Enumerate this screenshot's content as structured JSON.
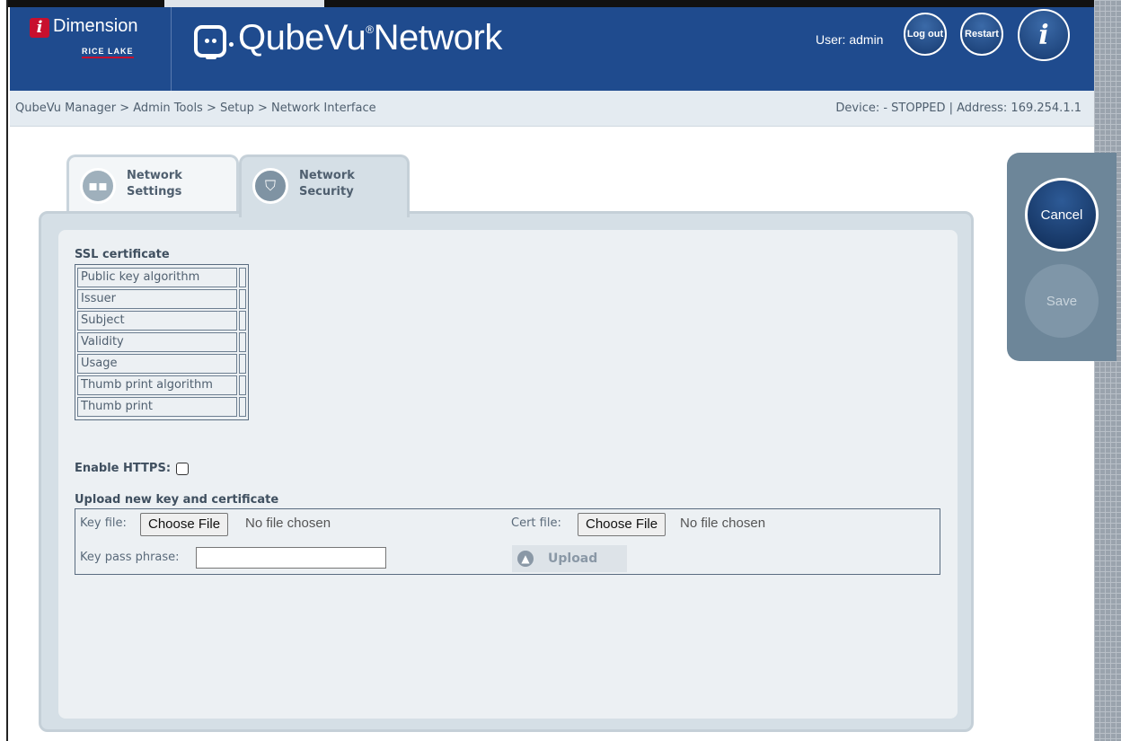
{
  "header": {
    "brand_name": "Dimension",
    "brand_sub": "RICE LAKE",
    "app_title": "QubeVu",
    "app_title_mark": "®",
    "app_title_suffix": "Network",
    "user_label": "User: admin",
    "logout_label": "Log out",
    "restart_label": "Restart",
    "info_label": "i"
  },
  "breadcrumb": "QubeVu Manager > Admin Tools > Setup > Network Interface",
  "device_status": "Device: - STOPPED | Address: 169.254.1.1",
  "tabs": [
    {
      "line1": "Network",
      "line2": "Settings",
      "active": false
    },
    {
      "line1": "Network",
      "line2": "Security",
      "active": true
    }
  ],
  "ssl": {
    "title": "SSL certificate",
    "rows": [
      "Public key algorithm",
      "Issuer",
      "Subject",
      "Validity",
      "Usage",
      "Thumb print algorithm",
      "Thumb print"
    ]
  },
  "https": {
    "label": "Enable HTTPS:",
    "checked": false
  },
  "upload": {
    "title": "Upload new key and certificate",
    "key_file_label": "Key file:",
    "cert_file_label": "Cert file:",
    "choose_file": "Choose File",
    "no_file": "No file chosen",
    "pass_label": "Key pass phrase:",
    "pass_value": "",
    "upload_label": "Upload"
  },
  "actions": {
    "cancel": "Cancel",
    "save": "Save"
  }
}
